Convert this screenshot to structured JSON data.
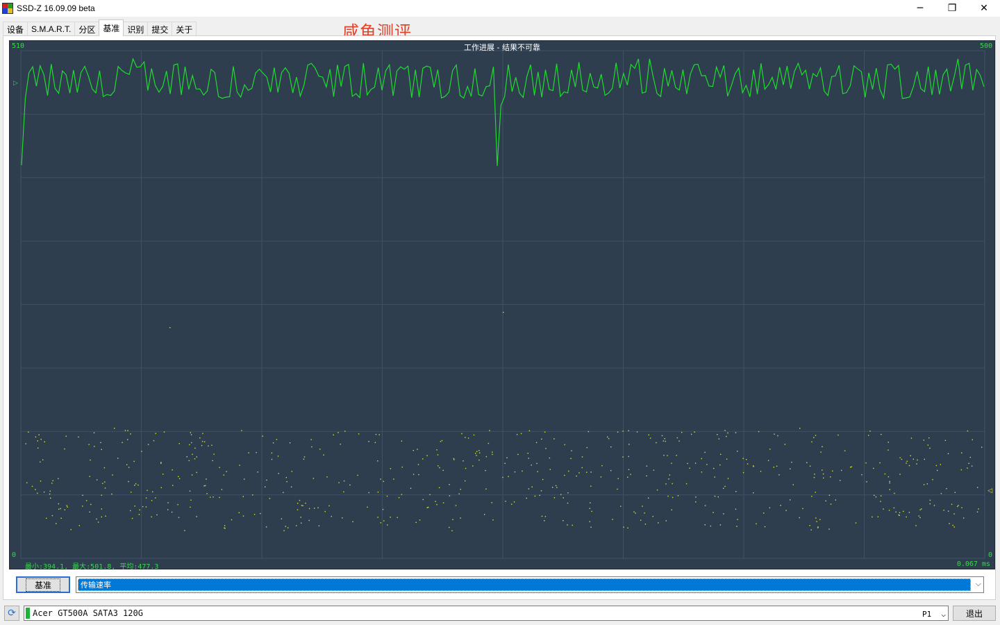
{
  "window": {
    "title": "SSD-Z 16.09.09 beta",
    "minimize_glyph": "─",
    "maximize_glyph": "❐",
    "close_glyph": "✕"
  },
  "tabs": [
    {
      "label": "设备",
      "active": false
    },
    {
      "label": "S.M.A.R.T.",
      "active": false
    },
    {
      "label": "分区",
      "active": false
    },
    {
      "label": "基准",
      "active": true
    },
    {
      "label": "识别",
      "active": false
    },
    {
      "label": "提交",
      "active": false
    },
    {
      "label": "关于",
      "active": false
    }
  ],
  "watermark": "咸鱼测评",
  "chart": {
    "title": "工作进展 - 结果不可靠",
    "left_axis_max": "510",
    "left_axis_min": "0",
    "right_axis_max": "500",
    "right_axis_min": "0",
    "stats": "最小:394.1, 最大:501.8, 平均:477.3",
    "access_time": "0.067 ms",
    "colors": {
      "background": "#2e3e4f",
      "grid": "#3f5164",
      "transfer_line": "#1fdc2f",
      "access_dots": "#d8e03a",
      "axis_labels": "#39d84d"
    }
  },
  "chart_data": {
    "type": "line",
    "series": [
      {
        "name": "传输速率",
        "y_range": [
          0,
          510
        ],
        "min": 394.1,
        "max": 501.8,
        "avg": 477.3
      }
    ],
    "secondary": {
      "type": "scatter",
      "y_range": [
        0,
        500
      ]
    },
    "grid": true
  },
  "controls": {
    "bench_button": "基准",
    "metric_selected": "传输速率"
  },
  "statusbar": {
    "refresh_icon": "refresh-icon",
    "drive_name": "Acer GT500A SATA3 120G",
    "port": "P1",
    "exit_button": "退出"
  }
}
